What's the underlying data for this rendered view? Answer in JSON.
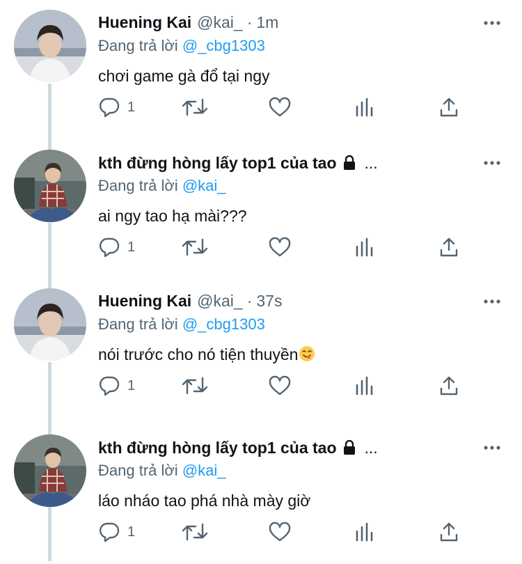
{
  "thread": {
    "tweets": [
      {
        "display_name": "Huening Kai",
        "handle": "@kai_",
        "separator": "·",
        "time": "1m",
        "reply_prefix": "Đang trả lời",
        "reply_to": "@_cbg1303",
        "text": "chơi game gà đổ tại ngy",
        "reply_count": "1",
        "protected": false,
        "avatar": "avatar-huening-kai"
      },
      {
        "display_name": "kth đừng hòng lấy top1 của tao",
        "handle": "",
        "separator": "",
        "time": "",
        "name_overflow": "...",
        "reply_prefix": "Đang trả lời",
        "reply_to": "@kai_",
        "text": "ai ngy tao hạ mài???",
        "reply_count": "1",
        "protected": true,
        "avatar": "avatar-kth"
      },
      {
        "display_name": "Huening Kai",
        "handle": "@kai_",
        "separator": "·",
        "time": "37s",
        "reply_prefix": "Đang trả lời",
        "reply_to": "@_cbg1303",
        "text": "nói trước cho nó tiện thuyền",
        "text_emoji": "face-savoring-food-emoji",
        "reply_count": "1",
        "protected": false,
        "avatar": "avatar-huening-kai"
      },
      {
        "display_name": "kth đừng hòng lấy top1 của tao",
        "handle": "",
        "separator": "",
        "time": "",
        "name_overflow": "...",
        "reply_prefix": "Đang trả lời",
        "reply_to": "@kai_",
        "text": "láo nháo tao phá nhà mày giờ",
        "reply_count": "1",
        "protected": true,
        "avatar": "avatar-kth"
      }
    ]
  },
  "icons": [
    "more-icon",
    "reply-icon",
    "retweet-icon",
    "like-icon",
    "views-icon",
    "share-icon",
    "lock-icon"
  ],
  "colors": {
    "text": "#0f1419",
    "secondary": "#536471",
    "link": "#1d9bf0",
    "thread_line": "#cfd9de"
  }
}
